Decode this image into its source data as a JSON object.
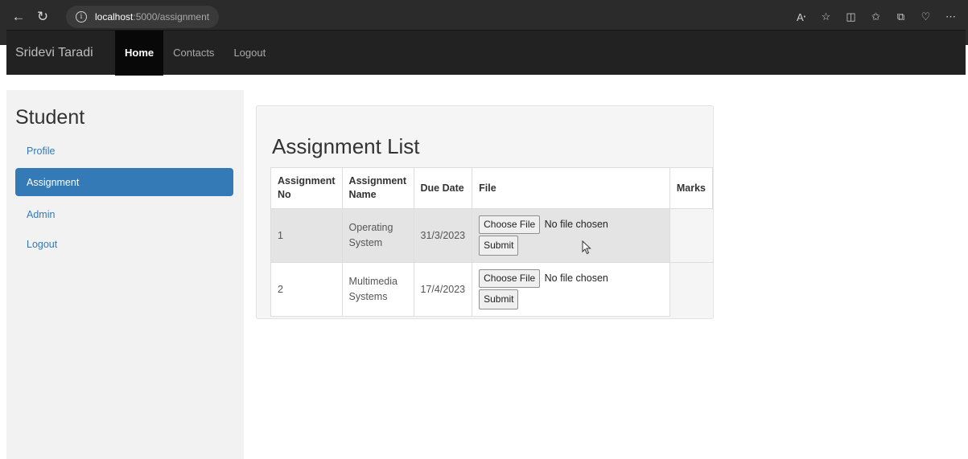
{
  "browser": {
    "address_host": "localhost",
    "address_path": ":5000/assignment",
    "icons": [
      "read-aloud-icon",
      "favorite-star-icon",
      "split-screen-icon",
      "favorites-list-icon",
      "collections-icon",
      "browser-essentials-icon",
      "more-menu-icon"
    ]
  },
  "navbar": {
    "brand": "Sridevi Taradi",
    "links": [
      "Home",
      "Contacts",
      "Logout"
    ],
    "active": "Home"
  },
  "sidebar": {
    "title": "Student",
    "items": [
      "Profile",
      "Assignment",
      "Admin",
      "Logout"
    ],
    "active": "Assignment"
  },
  "main": {
    "title": "Assignment List",
    "columns": [
      "Assignment No",
      "Assignment Name",
      "Due Date",
      "File",
      "Marks"
    ],
    "rows": [
      {
        "no": "1",
        "name": "Operating System",
        "due": "31/3/2023",
        "file_button": "Choose File",
        "file_status": "No file chosen",
        "submit": "Submit",
        "marks": ""
      },
      {
        "no": "2",
        "name": "Multimedia Systems",
        "due": "17/4/2023",
        "file_button": "Choose File",
        "file_status": "No file chosen",
        "submit": "Submit",
        "marks": ""
      }
    ]
  },
  "colors": {
    "navbar_bg": "#222222",
    "active_link_bg": "#080808",
    "sidebar_active": "#337ab7",
    "link": "#337ab7"
  }
}
